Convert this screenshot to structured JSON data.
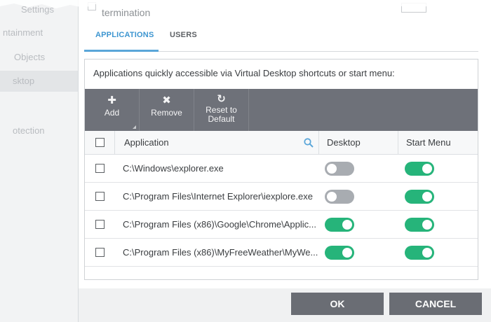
{
  "sidebar": {
    "items": [
      {
        "label": "Settings"
      },
      {
        "label": "ntainment"
      },
      {
        "label": "Objects"
      },
      {
        "label": "sktop"
      },
      {
        "label": "otection"
      }
    ]
  },
  "top": {
    "checkbox_label": "termination"
  },
  "tabs": [
    {
      "label": "APPLICATIONS",
      "active": true
    },
    {
      "label": "USERS",
      "active": false
    }
  ],
  "description": "Applications quickly accessible via Virtual Desktop shortcuts or start menu:",
  "toolbar": {
    "add": {
      "icon": "plus-icon",
      "label": "Add"
    },
    "remove": {
      "icon": "x-icon",
      "label": "Remove"
    },
    "reset": {
      "icon": "refresh-icon",
      "label_line1": "Reset to",
      "label_line2": "Default"
    }
  },
  "table": {
    "columns": {
      "application": "Application",
      "desktop": "Desktop",
      "start_menu": "Start Menu"
    },
    "rows": [
      {
        "path": "C:\\Windows\\explorer.exe",
        "desktop": false,
        "start_menu": true
      },
      {
        "path": "C:\\Program Files\\Internet Explorer\\iexplore.exe",
        "desktop": false,
        "start_menu": true
      },
      {
        "path": "C:\\Program Files (x86)\\Google\\Chrome\\Applic...",
        "desktop": true,
        "start_menu": true
      },
      {
        "path": "C:\\Program Files (x86)\\MyFreeWeather\\MyWe...",
        "desktop": true,
        "start_menu": true
      }
    ]
  },
  "buttons": {
    "ok": "OK",
    "cancel": "CANCEL"
  },
  "colors": {
    "accent": "#3c95d0",
    "toggle_on": "#26b47a",
    "toggle_off": "#a8acb1",
    "toolbar_bg": "#6e7179"
  }
}
